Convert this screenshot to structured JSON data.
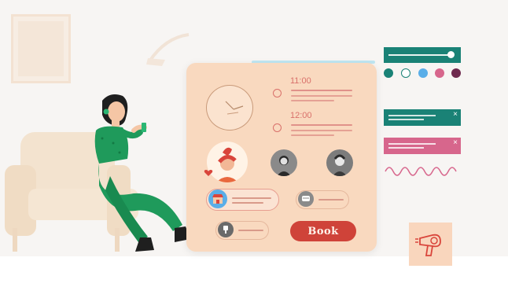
{
  "booking": {
    "time_slots": [
      "11:00",
      "12:00"
    ],
    "book_label": "Book"
  },
  "colors": {
    "panel": "#f9d9bf",
    "accent_red": "#cf4339",
    "teal": "#1a8276",
    "pink": "#d7668c",
    "swatches": [
      "#1a8276",
      "#ffffff",
      "#5aaee8",
      "#d7668c",
      "#6f2a4e"
    ]
  },
  "icons": {
    "clock": "clock-icon",
    "shop": "shop-awning-icon",
    "mirror": "mirror-icon",
    "hair_tool": "hair-tool-icon",
    "dryer": "hair-dryer-icon"
  }
}
